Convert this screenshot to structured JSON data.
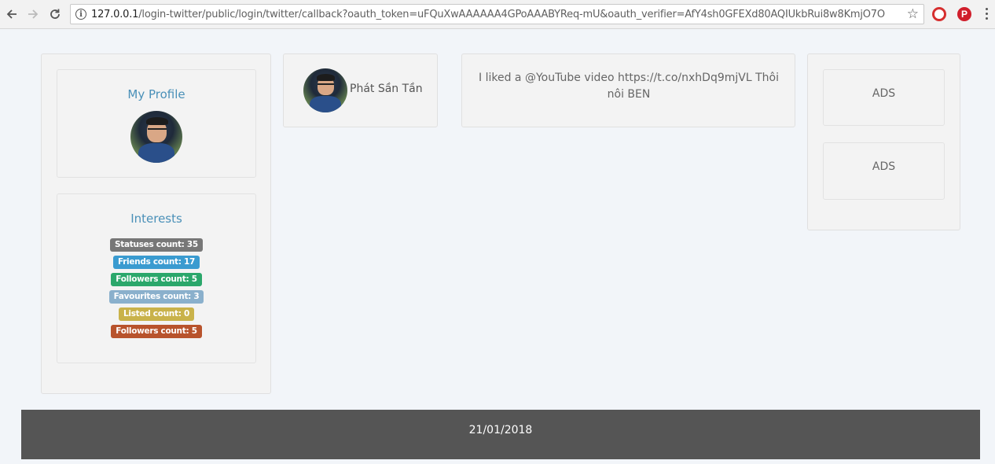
{
  "browser": {
    "url_host": "127.0.0.1",
    "url_path": "/login-twitter/public/login/twitter/callback?oauth_token=uFQuXwAAAAAA4GPoAAABYReq-mU&oauth_verifier=AfY4sh0GFEXd80AQIUkbRui8w8KmjO7O",
    "icons": [
      "back-arrow-icon",
      "forward-arrow-icon",
      "reload-icon",
      "info-icon",
      "bookmark-star-icon",
      "opera-extension-icon",
      "pinterest-extension-icon",
      "menu-dots-icon"
    ]
  },
  "profile": {
    "title": "My Profile"
  },
  "interests": {
    "title": "Interests",
    "badges": [
      {
        "label": "Statuses count: 35",
        "color": "#777777"
      },
      {
        "label": "Friends count: 17",
        "color": "#3a9bd0"
      },
      {
        "label": "Followers count: 5",
        "color": "#2ba76b"
      },
      {
        "label": "Favourites count: 3",
        "color": "#8ab0cc"
      },
      {
        "label": "Listed count: 0",
        "color": "#c9b24a"
      },
      {
        "label": "Followers count: 5",
        "color": "#b8532c"
      }
    ]
  },
  "user": {
    "name": "Phát Sần Tần"
  },
  "tweet": {
    "text": "I liked a @YouTube video https://t.co/nxhDq9mjVL Thôi nôi BEN"
  },
  "ads": {
    "items": [
      "ADS",
      "ADS"
    ]
  },
  "footer": {
    "date": "21/01/2018"
  }
}
